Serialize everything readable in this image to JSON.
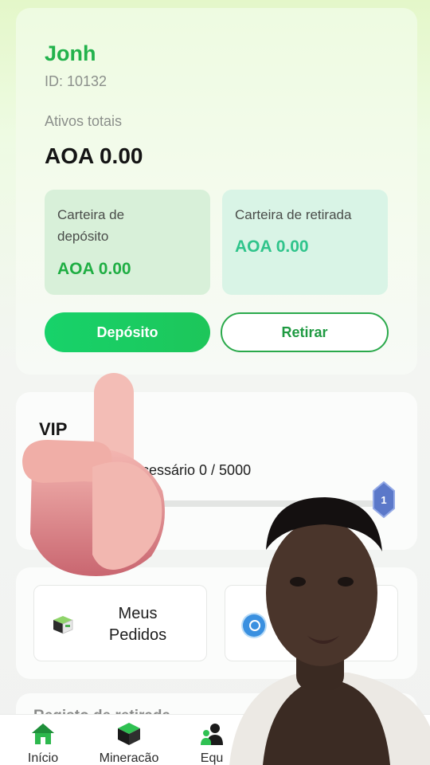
{
  "profile": {
    "username": "Jonh",
    "user_id": "ID: 10132",
    "assets_label": "Ativos totais",
    "assets_value": "AOA 0.00",
    "deposit_wallet": {
      "label_line1": "Carteira de",
      "label_line2": "depósito",
      "amount": "AOA 0.00"
    },
    "withdraw_wallet": {
      "label": "Carteira de retirada",
      "amount": "AOA 0.00"
    },
    "deposit_button": "Depósito",
    "withdraw_button": "Retirar"
  },
  "vip": {
    "title": "VIP",
    "progress_text": "ecessário 0 / 5000",
    "progress_fraction": 0,
    "badge_level": "1",
    "badge_color": "#5b78c9"
  },
  "shortcuts": {
    "orders_line1": "Meus",
    "orders_line2": "Pedidos",
    "orders_icon": "box-icon",
    "other_icon": "alarm-clock-icon"
  },
  "next_section": {
    "title": "Registo de retirada"
  },
  "nav": {
    "home": "Início",
    "mining": "Mineracão",
    "team": "Equ",
    "home_icon": "home-icon",
    "mining_icon": "cube-icon",
    "team_icon": "team-icon"
  },
  "colors": {
    "brand_green": "#22b24c",
    "button_gradient_start": "#17d26a",
    "withdraw_text": "#1f9a42"
  }
}
